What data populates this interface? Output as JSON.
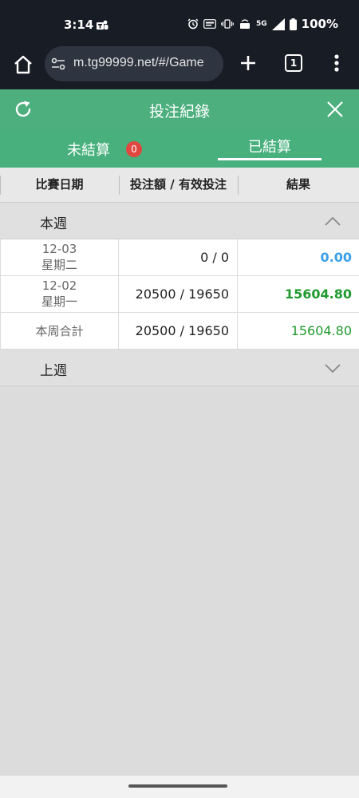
{
  "status_bar": {
    "time": "3:14",
    "battery": "100%",
    "network": "5G",
    "icons": [
      "teams-icon",
      "alarm-icon",
      "auto-icon",
      "vibrate-icon",
      "volte-icon",
      "signal-icon",
      "battery-icon"
    ]
  },
  "browser": {
    "url": "m.tg99999.net/#/Game",
    "tab_count": "1"
  },
  "header": {
    "title": "投注紀錄"
  },
  "tabs": [
    {
      "label": "未結算",
      "badge": "0",
      "active": false
    },
    {
      "label": "已結算",
      "active": true
    }
  ],
  "columns": [
    "比賽日期",
    "投注額 / 有效投注",
    "結果"
  ],
  "sections": {
    "this_week": {
      "label": "本週",
      "expanded": true
    },
    "last_week": {
      "label": "上週",
      "expanded": false
    }
  },
  "rows": [
    {
      "date": "12-03",
      "weekday": "星期二",
      "amount": "0 / 0",
      "result": "0.00"
    },
    {
      "date": "12-02",
      "weekday": "星期一",
      "amount": "20500 / 19650",
      "result": "15604.80"
    }
  ],
  "total": {
    "label": "本周合計",
    "amount": "20500 / 19650",
    "result": "15604.80"
  },
  "colors": {
    "header_green": "#4caf7d",
    "tab_green": "#47b07c",
    "badge_red": "#e0473f",
    "result_blue": "#3aa0e8",
    "result_green": "#1f9a2e",
    "system_bar": "#181c25"
  }
}
